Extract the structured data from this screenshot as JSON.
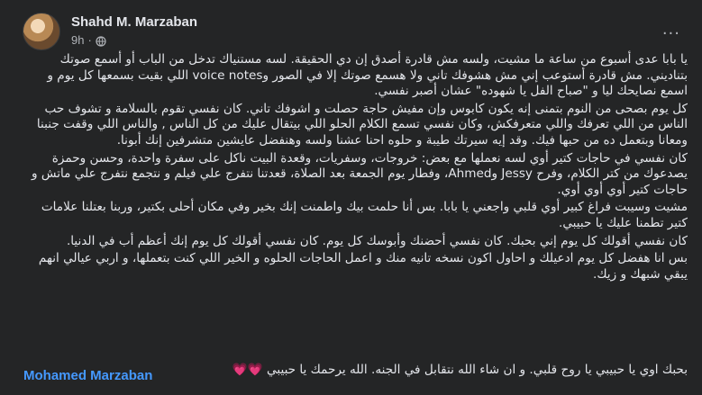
{
  "post": {
    "author": "Shahd M. Marzaban",
    "time": "9h",
    "separator": "·",
    "more": "...",
    "paragraphs": [
      "يا بابا عدى أسبوع من ساعة ما مشيت، ولسه مش قادرة أصدق إن دي الحقيقة. لسه مستنياك تدخل من الباب أو أسمع صوتك بتناديني. مش قادرة أستوعب إني مش هشوفك تاني ولا هسمع صوتك إلا في الصور وvoice notes اللي بقيت بسمعها كل يوم و اسمع نصايحك ليا و \"صباح الفل يا شهوده\" عشان أصبر نفسي.",
      "كل يوم بصحى من النوم بتمنى إنه يكون كابوس وإن مفيش حاجة حصلت و اشوفك تاني. كان نفسي تقوم بالسلامة و تشوف حب الناس من اللي تعرفك واللي متعرفكش، وكان نفسي تسمع الكلام الحلو اللي بيتقال عليك من كل الناس , والناس اللي وقفت جنبنا ومعانا وبتعمل ده من حبها فيك. وقد إيه سيرتك طيبة و حلوه احنا عشنا ولسه وهنفضل عايشين متشرفين إنك أبونا.",
      "كان نفسي في حاجات كتير أوي لسه نعملها مع بعض: خروجات، وسفريات، وقعدة البيت ناكل على سفرة واحدة، وحسن وحمزة يصدعوك من كتر الكلام، وفرح Jessy وAhmed، وفطار يوم الجمعة بعد الصلاة، قعدتنا نتفرج علي فيلم و نتجمع نتفرج علي ماتش و حاجات كتير أوي أوي أوي.",
      "مشيت وسيبت فراغ كبير أوي قلبي واجعني يا بابا. بس أنا حلمت بيك واطمنت إنك بخير وفي مكان أحلى بكتير، وربنا بعتلنا علامات كتير تطمنا عليك يا حبيبي.",
      "كان نفسي أقولك كل يوم إني بحبك. كان نفسي أحضنك وأبوسك كل يوم. كان نفسي أقولك كل يوم إنك أعظم أب في الدنيا.",
      "بس انا هفضل كل يوم ادعيلك و احاول اكون نسخه تانيه منك و اعمل الحاجات الحلوه و الخير اللي كنت بتعملها، و اربي عيالي انهم يبقي شبهك و زيك."
    ],
    "closing": "بحبك اوي يا حبيبي يا روح قلبي. و ان شاء الله نتقابل في الجنه. الله يرحمك يا حبيبي",
    "hearts": "💗💗",
    "mention": "Mohamed Marzaban"
  },
  "colors": {
    "background": "#242526",
    "text": "#e4e6eb",
    "secondary": "#b0b3b8",
    "link": "#4599ff",
    "heart": "#ff5fa8"
  },
  "icons": {
    "privacy": "globe-icon",
    "options": "more-options-icon",
    "avatar": "profile-avatar"
  }
}
